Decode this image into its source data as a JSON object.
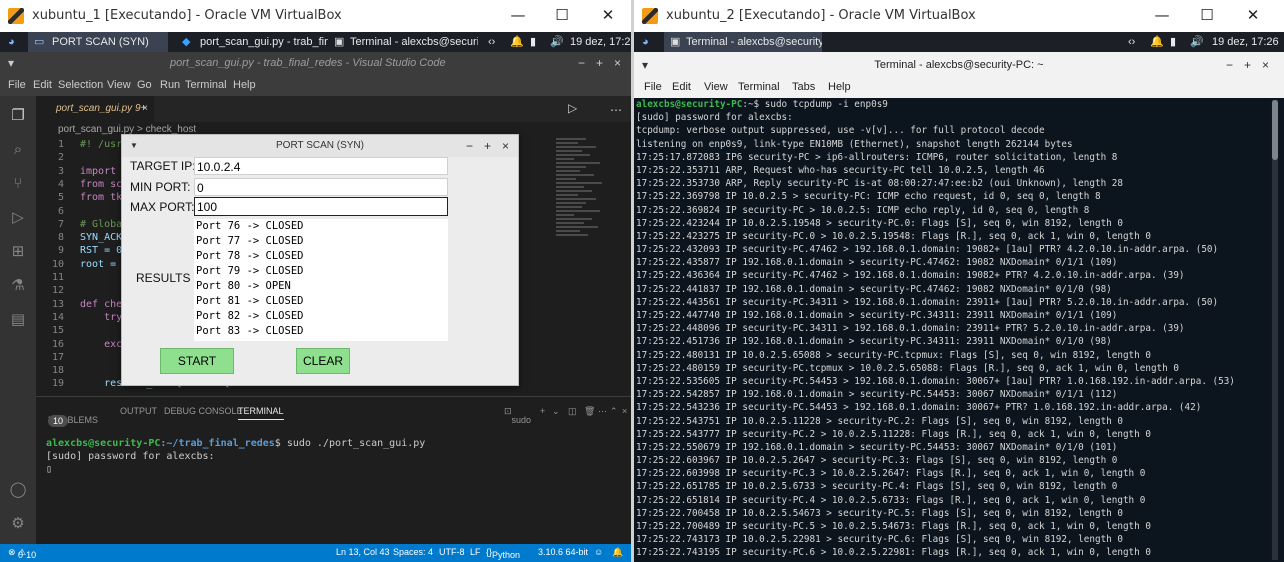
{
  "left": {
    "vbox_title": "xubuntu_1 [Executando] - Oracle VM VirtualBox",
    "panel": {
      "task1": "PORT SCAN (SYN)",
      "task2": "port_scan_gui.py - trab_fin...",
      "task3": "Terminal - alexcbs@securi...",
      "clock": "19 dez, 17:26"
    },
    "vscode": {
      "title": "port_scan_gui.py - trab_final_redes - Visual Studio Code",
      "menu": [
        "File",
        "Edit",
        "Selection",
        "View",
        "Go",
        "Run",
        "Terminal",
        "Help"
      ],
      "tab": "port_scan_gui.py 9+",
      "breadcrumb_file": "port_scan_gui.py",
      "breadcrumb_sep": ">",
      "breadcrumb_symbol": "check_host",
      "code_lines": [
        {
          "n": "1",
          "t": "#! /usr/"
        },
        {
          "n": "2",
          "t": ""
        },
        {
          "n": "3",
          "t": "import "
        },
        {
          "n": "4",
          "t": "from sca"
        },
        {
          "n": "5",
          "t": "from tki"
        },
        {
          "n": "6",
          "t": ""
        },
        {
          "n": "7",
          "t": "# Global"
        },
        {
          "n": "8",
          "t": "SYN_ACK "
        },
        {
          "n": "9",
          "t": "RST = 0x"
        },
        {
          "n": "10",
          "t": "root = T"
        },
        {
          "n": "11",
          "t": ""
        },
        {
          "n": "12",
          "t": ""
        },
        {
          "n": "13",
          "t": "def chec"
        },
        {
          "n": "14",
          "t": "    try:"
        },
        {
          "n": "15",
          "t": ""
        },
        {
          "n": "16",
          "t": "    exce"
        },
        {
          "n": "17",
          "t": ""
        },
        {
          "n": "18",
          "t": ""
        },
        {
          "n": "19",
          "t": "    results_text['state'] = 'disabled'"
        }
      ],
      "panel_tabs": {
        "problems": "PROBLEMS",
        "problems_count": "10",
        "output": "OUTPUT",
        "debug": "DEBUG CONSOLE",
        "terminal": "TERMINAL",
        "shell": "sudo"
      },
      "terminal_user": "alexcbs@security-PC",
      "terminal_path": ":~/trab_final_redes",
      "terminal_cmd": "$ sudo ./port_scan_gui.py",
      "terminal_line2": "[sudo] password for alexcbs:",
      "status": {
        "errors": "0",
        "warnings": "10",
        "position": "Ln 13, Col 43",
        "spaces": "Spaces: 4",
        "encoding": "UTF-8",
        "eol": "LF",
        "language": "Python",
        "interpreter": "3.10.6 64-bit"
      }
    },
    "dialog": {
      "title": "PORT SCAN (SYN)",
      "target_label": "TARGET IP:",
      "target_value": "10.0.2.4",
      "min_label": "MIN PORT:",
      "min_value": "0",
      "max_label": "MAX PORT:",
      "max_value": "100",
      "results_label": "RESULTS",
      "results": [
        "Port 76 -> CLOSED",
        "Port 77 -> CLOSED",
        "Port 78 -> CLOSED",
        "Port 79 -> CLOSED",
        "Port 80 -> OPEN",
        "Port 81 -> CLOSED",
        "Port 82 -> CLOSED",
        "Port 83 -> CLOSED"
      ],
      "start_label": "START",
      "clear_label": "CLEAR"
    }
  },
  "right": {
    "vbox_title": "xubuntu_2 [Executando] - Oracle VM VirtualBox",
    "panel": {
      "task1": "Terminal - alexcbs@security...",
      "clock": "19 dez, 17:26"
    },
    "terminal": {
      "title": "Terminal - alexcbs@security-PC: ~",
      "menu": [
        "File",
        "Edit",
        "View",
        "Terminal",
        "Tabs",
        "Help"
      ],
      "prompt_user": "alexcbs@security-PC",
      "prompt_cmd": ":~$ sudo tcpdump -i enp0s9",
      "lines": [
        "[sudo] password for alexcbs:",
        "tcpdump: verbose output suppressed, use -v[v]... for full protocol decode",
        "listening on enp0s9, link-type EN10MB (Ethernet), snapshot length 262144 bytes",
        "17:25:17.872083 IP6 security-PC > ip6-allrouters: ICMP6, router solicitation, length 8",
        "17:25:22.353711 ARP, Request who-has security-PC tell 10.0.2.5, length 46",
        "17:25:22.353730 ARP, Reply security-PC is-at 08:00:27:47:ee:b2 (oui Unknown), length 28",
        "17:25:22.369798 IP 10.0.2.5 > security-PC: ICMP echo request, id 0, seq 0, length 8",
        "17:25:22.369824 IP security-PC > 10.0.2.5: ICMP echo reply, id 0, seq 0, length 8",
        "17:25:22.423244 IP 10.0.2.5.19548 > security-PC.0: Flags [S], seq 0, win 8192, length 0",
        "17:25:22.423275 IP security-PC.0 > 10.0.2.5.19548: Flags [R.], seq 0, ack 1, win 0, length 0",
        "17:25:22.432093 IP security-PC.47462 > 192.168.0.1.domain: 19082+ [1au] PTR? 4.2.0.10.in-addr.arpa. (50)",
        "17:25:22.435877 IP 192.168.0.1.domain > security-PC.47462: 19082 NXDomain* 0/1/1 (109)",
        "17:25:22.436364 IP security-PC.47462 > 192.168.0.1.domain: 19082+ PTR? 4.2.0.10.in-addr.arpa. (39)",
        "17:25:22.441837 IP 192.168.0.1.domain > security-PC.47462: 19082 NXDomain* 0/1/0 (98)",
        "17:25:22.443561 IP security-PC.34311 > 192.168.0.1.domain: 23911+ [1au] PTR? 5.2.0.10.in-addr.arpa. (50)",
        "17:25:22.447740 IP 192.168.0.1.domain > security-PC.34311: 23911 NXDomain* 0/1/1 (109)",
        "17:25:22.448096 IP security-PC.34311 > 192.168.0.1.domain: 23911+ PTR? 5.2.0.10.in-addr.arpa. (39)",
        "17:25:22.451736 IP 192.168.0.1.domain > security-PC.34311: 23911 NXDomain* 0/1/0 (98)",
        "17:25:22.480131 IP 10.0.2.5.65088 > security-PC.tcpmux: Flags [S], seq 0, win 8192, length 0",
        "17:25:22.480159 IP security-PC.tcpmux > 10.0.2.5.65088: Flags [R.], seq 0, ack 1, win 0, length 0",
        "17:25:22.535605 IP security-PC.54453 > 192.168.0.1.domain: 30067+ [1au] PTR? 1.0.168.192.in-addr.arpa. (53)",
        "17:25:22.542857 IP 192.168.0.1.domain > security-PC.54453: 30067 NXDomain* 0/1/1 (112)",
        "17:25:22.543236 IP security-PC.54453 > 192.168.0.1.domain: 30067+ PTR? 1.0.168.192.in-addr.arpa. (42)",
        "17:25:22.543751 IP 10.0.2.5.11228 > security-PC.2: Flags [S], seq 0, win 8192, length 0",
        "17:25:22.543777 IP security-PC.2 > 10.0.2.5.11228: Flags [R.], seq 0, ack 1, win 0, length 0",
        "17:25:22.550679 IP 192.168.0.1.domain > security-PC.54453: 30067 NXDomain* 0/1/0 (101)",
        "17:25:22.603967 IP 10.0.2.5.2647 > security-PC.3: Flags [S], seq 0, win 8192, length 0",
        "17:25:22.603998 IP security-PC.3 > 10.0.2.5.2647: Flags [R.], seq 0, ack 1, win 0, length 0",
        "17:25:22.651785 IP 10.0.2.5.6733 > security-PC.4: Flags [S], seq 0, win 8192, length 0",
        "17:25:22.651814 IP security-PC.4 > 10.0.2.5.6733: Flags [R.], seq 0, ack 1, win 0, length 0",
        "17:25:22.700458 IP 10.0.2.5.54673 > security-PC.5: Flags [S], seq 0, win 8192, length 0",
        "17:25:22.700489 IP security-PC.5 > 10.0.2.5.54673: Flags [R.], seq 0, ack 1, win 0, length 0",
        "17:25:22.743173 IP 10.0.2.5.22981 > security-PC.6: Flags [S], seq 0, win 8192, length 0",
        "17:25:22.743195 IP security-PC.6 > 10.0.2.5.22981: Flags [R.], seq 0, ack 1, win 0, length 0"
      ]
    }
  },
  "colors": {
    "vscode_accent": "#007acc",
    "button_green": "#8ee08e",
    "prompt_green": "#3fb950",
    "prompt_blue": "#5a9bd5"
  }
}
